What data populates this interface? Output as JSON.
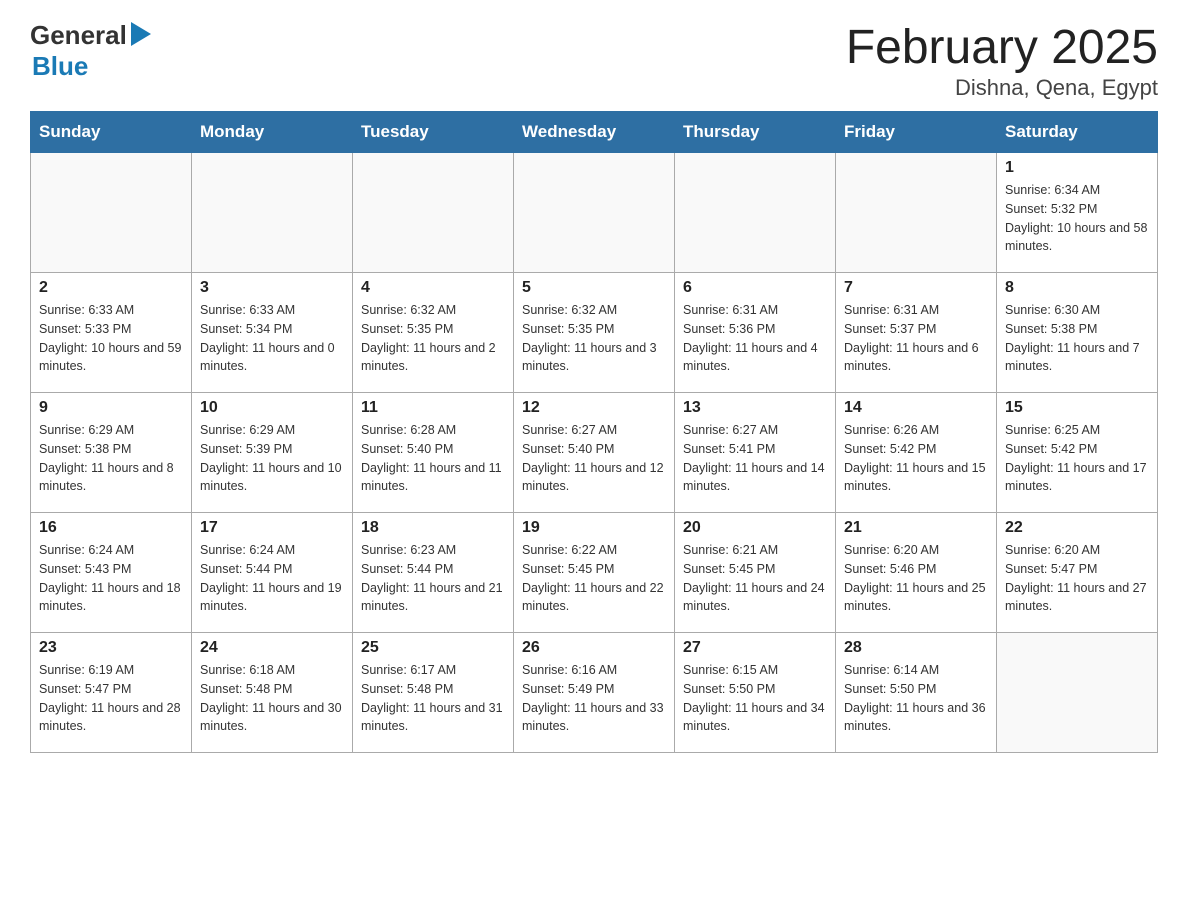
{
  "header": {
    "logo_general": "General",
    "logo_blue": "Blue",
    "title": "February 2025",
    "subtitle": "Dishna, Qena, Egypt"
  },
  "days_of_week": [
    "Sunday",
    "Monday",
    "Tuesday",
    "Wednesday",
    "Thursday",
    "Friday",
    "Saturday"
  ],
  "weeks": [
    {
      "days": [
        {
          "date": "",
          "info": ""
        },
        {
          "date": "",
          "info": ""
        },
        {
          "date": "",
          "info": ""
        },
        {
          "date": "",
          "info": ""
        },
        {
          "date": "",
          "info": ""
        },
        {
          "date": "",
          "info": ""
        },
        {
          "date": "1",
          "info": "Sunrise: 6:34 AM\nSunset: 5:32 PM\nDaylight: 10 hours and 58 minutes."
        }
      ]
    },
    {
      "days": [
        {
          "date": "2",
          "info": "Sunrise: 6:33 AM\nSunset: 5:33 PM\nDaylight: 10 hours and 59 minutes."
        },
        {
          "date": "3",
          "info": "Sunrise: 6:33 AM\nSunset: 5:34 PM\nDaylight: 11 hours and 0 minutes."
        },
        {
          "date": "4",
          "info": "Sunrise: 6:32 AM\nSunset: 5:35 PM\nDaylight: 11 hours and 2 minutes."
        },
        {
          "date": "5",
          "info": "Sunrise: 6:32 AM\nSunset: 5:35 PM\nDaylight: 11 hours and 3 minutes."
        },
        {
          "date": "6",
          "info": "Sunrise: 6:31 AM\nSunset: 5:36 PM\nDaylight: 11 hours and 4 minutes."
        },
        {
          "date": "7",
          "info": "Sunrise: 6:31 AM\nSunset: 5:37 PM\nDaylight: 11 hours and 6 minutes."
        },
        {
          "date": "8",
          "info": "Sunrise: 6:30 AM\nSunset: 5:38 PM\nDaylight: 11 hours and 7 minutes."
        }
      ]
    },
    {
      "days": [
        {
          "date": "9",
          "info": "Sunrise: 6:29 AM\nSunset: 5:38 PM\nDaylight: 11 hours and 8 minutes."
        },
        {
          "date": "10",
          "info": "Sunrise: 6:29 AM\nSunset: 5:39 PM\nDaylight: 11 hours and 10 minutes."
        },
        {
          "date": "11",
          "info": "Sunrise: 6:28 AM\nSunset: 5:40 PM\nDaylight: 11 hours and 11 minutes."
        },
        {
          "date": "12",
          "info": "Sunrise: 6:27 AM\nSunset: 5:40 PM\nDaylight: 11 hours and 12 minutes."
        },
        {
          "date": "13",
          "info": "Sunrise: 6:27 AM\nSunset: 5:41 PM\nDaylight: 11 hours and 14 minutes."
        },
        {
          "date": "14",
          "info": "Sunrise: 6:26 AM\nSunset: 5:42 PM\nDaylight: 11 hours and 15 minutes."
        },
        {
          "date": "15",
          "info": "Sunrise: 6:25 AM\nSunset: 5:42 PM\nDaylight: 11 hours and 17 minutes."
        }
      ]
    },
    {
      "days": [
        {
          "date": "16",
          "info": "Sunrise: 6:24 AM\nSunset: 5:43 PM\nDaylight: 11 hours and 18 minutes."
        },
        {
          "date": "17",
          "info": "Sunrise: 6:24 AM\nSunset: 5:44 PM\nDaylight: 11 hours and 19 minutes."
        },
        {
          "date": "18",
          "info": "Sunrise: 6:23 AM\nSunset: 5:44 PM\nDaylight: 11 hours and 21 minutes."
        },
        {
          "date": "19",
          "info": "Sunrise: 6:22 AM\nSunset: 5:45 PM\nDaylight: 11 hours and 22 minutes."
        },
        {
          "date": "20",
          "info": "Sunrise: 6:21 AM\nSunset: 5:45 PM\nDaylight: 11 hours and 24 minutes."
        },
        {
          "date": "21",
          "info": "Sunrise: 6:20 AM\nSunset: 5:46 PM\nDaylight: 11 hours and 25 minutes."
        },
        {
          "date": "22",
          "info": "Sunrise: 6:20 AM\nSunset: 5:47 PM\nDaylight: 11 hours and 27 minutes."
        }
      ]
    },
    {
      "days": [
        {
          "date": "23",
          "info": "Sunrise: 6:19 AM\nSunset: 5:47 PM\nDaylight: 11 hours and 28 minutes."
        },
        {
          "date": "24",
          "info": "Sunrise: 6:18 AM\nSunset: 5:48 PM\nDaylight: 11 hours and 30 minutes."
        },
        {
          "date": "25",
          "info": "Sunrise: 6:17 AM\nSunset: 5:48 PM\nDaylight: 11 hours and 31 minutes."
        },
        {
          "date": "26",
          "info": "Sunrise: 6:16 AM\nSunset: 5:49 PM\nDaylight: 11 hours and 33 minutes."
        },
        {
          "date": "27",
          "info": "Sunrise: 6:15 AM\nSunset: 5:50 PM\nDaylight: 11 hours and 34 minutes."
        },
        {
          "date": "28",
          "info": "Sunrise: 6:14 AM\nSunset: 5:50 PM\nDaylight: 11 hours and 36 minutes."
        },
        {
          "date": "",
          "info": ""
        }
      ]
    }
  ]
}
